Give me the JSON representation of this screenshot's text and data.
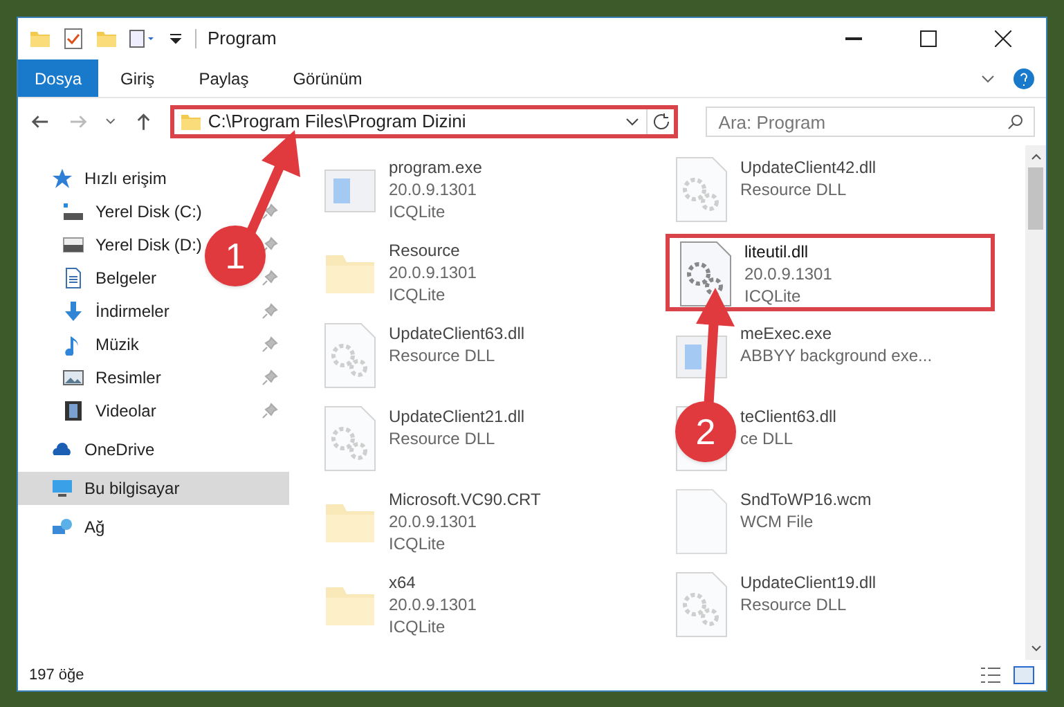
{
  "window": {
    "title": "Program"
  },
  "ribbon_tabs": [
    {
      "label": "Dosya",
      "selected": true
    },
    {
      "label": "Giriş",
      "selected": false
    },
    {
      "label": "Paylaş",
      "selected": false
    },
    {
      "label": "Görünüm",
      "selected": false
    }
  ],
  "address": {
    "value": "C:\\Program Files\\Program Dizini",
    "highlighted": true
  },
  "search": {
    "placeholder": "Ara: Program"
  },
  "sidebar": {
    "items": [
      {
        "label": "Hızlı erişim",
        "selected": false,
        "children": [
          {
            "label": "Yerel Disk (C:)",
            "pinned": true,
            "selected": false
          },
          {
            "label": "Yerel Disk (D:)",
            "pinned": true,
            "selected": false
          },
          {
            "label": "Belgeler",
            "pinned": true,
            "selected": false
          },
          {
            "label": "İndirmeler",
            "pinned": true,
            "selected": false
          },
          {
            "label": "Müzik",
            "pinned": true,
            "selected": false
          },
          {
            "label": "Resimler",
            "pinned": true,
            "selected": false
          },
          {
            "label": "Videolar",
            "pinned": true,
            "selected": false
          }
        ]
      },
      {
        "label": "OneDrive",
        "selected": false
      },
      {
        "label": "Bu bilgisayar",
        "selected": true
      },
      {
        "label": "Ağ",
        "selected": false
      }
    ]
  },
  "files": [
    {
      "kind": "exe",
      "name": "program.exe",
      "lines": [
        "20.0.9.1301",
        "ICQLite"
      ],
      "highlighted": false
    },
    {
      "kind": "dll",
      "name": "UpdateClient42.dll",
      "lines": [
        "Resource DLL"
      ],
      "highlighted": false
    },
    {
      "kind": "folder",
      "name": "Resource",
      "lines": [
        "20.0.9.1301",
        "ICQLite"
      ],
      "highlighted": false
    },
    {
      "kind": "dll",
      "name": "liteutil.dll",
      "lines": [
        "20.0.9.1301",
        "ICQLite"
      ],
      "highlighted": true
    },
    {
      "kind": "dll",
      "name": "UpdateClient63.dll",
      "lines": [
        "Resource DLL"
      ],
      "highlighted": false
    },
    {
      "kind": "exe",
      "name": "meExec.exe",
      "lines": [
        "ABBYY background exe..."
      ],
      "highlighted": false
    },
    {
      "kind": "dll",
      "name": "UpdateClient21.dll",
      "lines": [
        "Resource DLL"
      ],
      "highlighted": false
    },
    {
      "kind": "dll",
      "name": "teClient63.dll",
      "lines": [
        "ce DLL"
      ],
      "highlighted": false
    },
    {
      "kind": "folder",
      "name": "Microsoft.VC90.CRT",
      "lines": [
        "20.0.9.1301",
        "ICQLite"
      ],
      "highlighted": false
    },
    {
      "kind": "file",
      "name": "SndToWP16.wcm",
      "lines": [
        "WCM File"
      ],
      "highlighted": false
    },
    {
      "kind": "folder",
      "name": "x64",
      "lines": [
        "20.0.9.1301",
        "ICQLite"
      ],
      "highlighted": false
    },
    {
      "kind": "dll",
      "name": "UpdateClient19.dll",
      "lines": [
        "Resource DLL"
      ],
      "highlighted": false
    }
  ],
  "status_bar": {
    "count": "197 öğe"
  },
  "annotations": [
    {
      "label": "1"
    },
    {
      "label": "2"
    }
  ]
}
